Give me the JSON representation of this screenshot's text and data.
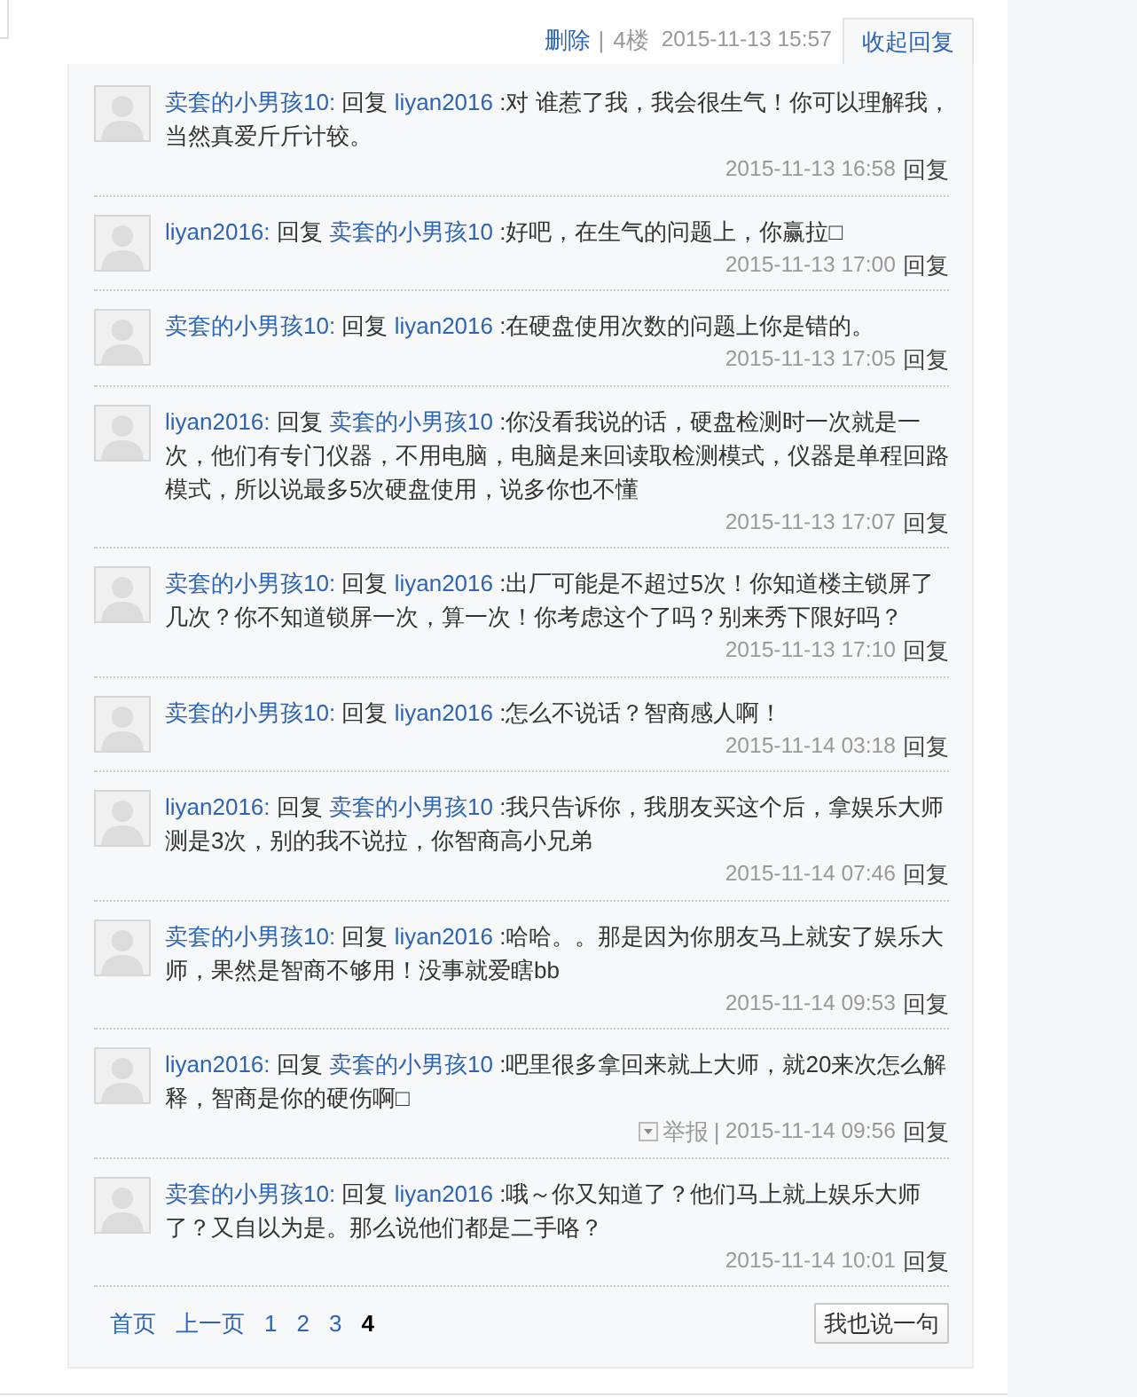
{
  "floor_bar": {
    "delete_link": "删除",
    "divider": "|",
    "floor": "4楼",
    "time": "2015-11-13 15:57",
    "collapse_tab": "收起回复"
  },
  "replies": [
    {
      "author": "卖套的小男孩10:",
      "action": "回复",
      "target": "liyan2016",
      "text": ":对 谁惹了我，我会很生气！你可以理解我，当然真爱斤斤计较。",
      "time": "2015-11-13 16:58",
      "reply_link": "回复"
    },
    {
      "author": "liyan2016:",
      "action": "回复",
      "target": "卖套的小男孩10",
      "text": ":好吧，在生气的问题上，你赢拉□",
      "time": "2015-11-13 17:00",
      "reply_link": "回复"
    },
    {
      "author": "卖套的小男孩10:",
      "action": "回复",
      "target": "liyan2016",
      "text": ":在硬盘使用次数的问题上你是错的。",
      "time": "2015-11-13 17:05",
      "reply_link": "回复"
    },
    {
      "author": "liyan2016:",
      "action": "回复",
      "target": "卖套的小男孩10",
      "text": ":你没看我说的话，硬盘检测时一次就是一次，他们有专门仪器，不用电脑，电脑是来回读取检测模式，仪器是单程回路模式，所以说最多5次硬盘使用，说多你也不懂",
      "time": "2015-11-13 17:07",
      "reply_link": "回复"
    },
    {
      "author": "卖套的小男孩10:",
      "action": "回复",
      "target": "liyan2016",
      "text": ":出厂可能是不超过5次！你知道楼主锁屏了几次？你不知道锁屏一次，算一次！你考虑这个了吗？别来秀下限好吗？",
      "time": "2015-11-13 17:10",
      "reply_link": "回复"
    },
    {
      "author": "卖套的小男孩10:",
      "action": "回复",
      "target": "liyan2016",
      "text": ":怎么不说话？智商感人啊！",
      "time": "2015-11-14 03:18",
      "reply_link": "回复"
    },
    {
      "author": "liyan2016:",
      "action": "回复",
      "target": "卖套的小男孩10",
      "text": ":我只告诉你，我朋友买这个后，拿娱乐大师测是3次，别的我不说拉，你智商高小兄弟",
      "time": "2015-11-14 07:46",
      "reply_link": "回复"
    },
    {
      "author": "卖套的小男孩10:",
      "action": "回复",
      "target": "liyan2016",
      "text": ":哈哈。。那是因为你朋友马上就安了娱乐大师，果然是智商不够用！没事就爱瞎bb",
      "time": "2015-11-14 09:53",
      "reply_link": "回复"
    },
    {
      "author": "liyan2016:",
      "action": "回复",
      "target": "卖套的小男孩10",
      "text": ":吧里很多拿回来就上大师，就20来次怎么解释，智商是你的硬伤啊□",
      "report": "举报",
      "report_divider": "|",
      "time": "2015-11-14 09:56",
      "reply_link": "回复"
    },
    {
      "author": "卖套的小男孩10:",
      "action": "回复",
      "target": "liyan2016",
      "text": ":哦～你又知道了？他们马上就上娱乐大师了？又自以为是。那么说他们都是二手咯？",
      "time": "2015-11-14 10:01",
      "reply_link": "回复"
    }
  ],
  "pagination": {
    "items": [
      {
        "label": "首页",
        "selected": false
      },
      {
        "label": "上一页",
        "selected": false
      },
      {
        "label": "1",
        "selected": false
      },
      {
        "label": "2",
        "selected": false
      },
      {
        "label": "3",
        "selected": false
      },
      {
        "label": "4",
        "selected": true
      }
    ],
    "post_button": "我也说一句"
  }
}
